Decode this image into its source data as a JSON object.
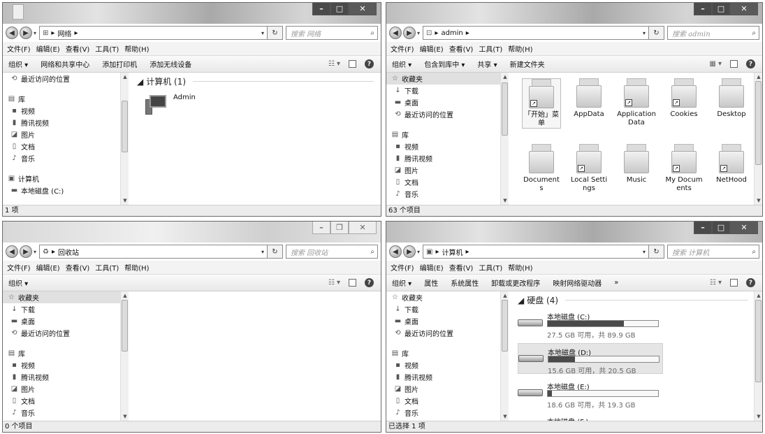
{
  "w1": {
    "address": [
      "网络"
    ],
    "search": "搜索 网络",
    "menu": [
      "文件(F)",
      "编辑(E)",
      "查看(V)",
      "工具(T)",
      "帮助(H)"
    ],
    "toolbar": [
      "组织 ▾",
      "网络和共享中心",
      "添加打印机",
      "添加无线设备"
    ],
    "nav": [
      {
        "label": "最近访问的位置",
        "icon": "recent-icon"
      },
      {
        "label": "库",
        "icon": "library-icon",
        "head": true
      },
      {
        "label": "视频",
        "icon": "video-icon"
      },
      {
        "label": "腾讯视频",
        "icon": "folder-icon"
      },
      {
        "label": "图片",
        "icon": "pictures-icon"
      },
      {
        "label": "文档",
        "icon": "docs-icon"
      },
      {
        "label": "音乐",
        "icon": "music-icon"
      },
      {
        "label": "计算机",
        "icon": "computer-icon",
        "head": true
      },
      {
        "label": "本地磁盘 (C:)",
        "icon": "drive-icon"
      }
    ],
    "group": "计算机 (1)",
    "items": [
      "Admin"
    ],
    "status": "1 项"
  },
  "w2": {
    "address": [
      "admin"
    ],
    "search": "搜索 admin",
    "menu": [
      "文件(F)",
      "编辑(E)",
      "查看(V)",
      "工具(T)",
      "帮助(H)"
    ],
    "toolbar": [
      "组织 ▾",
      "包含到库中 ▾",
      "共享 ▾",
      "新建文件夹"
    ],
    "nav": [
      {
        "label": "收藏夹",
        "icon": "star-icon",
        "head": true,
        "sel": true
      },
      {
        "label": "下载",
        "icon": "download-icon"
      },
      {
        "label": "桌面",
        "icon": "desktop-icon"
      },
      {
        "label": "最近访问的位置",
        "icon": "recent-icon"
      },
      {
        "label": "库",
        "icon": "library-icon",
        "head": true
      },
      {
        "label": "视频",
        "icon": "video-icon"
      },
      {
        "label": "腾讯视频",
        "icon": "folder-icon"
      },
      {
        "label": "图片",
        "icon": "pictures-icon"
      },
      {
        "label": "文档",
        "icon": "docs-icon"
      },
      {
        "label": "音乐",
        "icon": "music-icon"
      }
    ],
    "folders": [
      {
        "label": "「开始」菜单",
        "shortcut": true,
        "sel": true
      },
      {
        "label": "AppData"
      },
      {
        "label": "Application Data",
        "shortcut": true
      },
      {
        "label": "Cookies",
        "shortcut": true
      },
      {
        "label": "Desktop"
      },
      {
        "label": "Documents"
      },
      {
        "label": "Local Settings",
        "shortcut": true
      },
      {
        "label": "Music"
      },
      {
        "label": "My Documents",
        "shortcut": true
      },
      {
        "label": "NetHood",
        "shortcut": true
      }
    ],
    "status": "63 个项目"
  },
  "w3": {
    "address": [
      "回收站"
    ],
    "search": "搜索 回收站",
    "menu": [
      "文件(F)",
      "编辑(E)",
      "查看(V)",
      "工具(T)",
      "帮助(H)"
    ],
    "toolbar": [
      "组织 ▾"
    ],
    "nav": [
      {
        "label": "收藏夹",
        "icon": "star-icon",
        "head": true,
        "sel": true
      },
      {
        "label": "下载",
        "icon": "download-icon"
      },
      {
        "label": "桌面",
        "icon": "desktop-icon"
      },
      {
        "label": "最近访问的位置",
        "icon": "recent-icon"
      },
      {
        "label": "库",
        "icon": "library-icon",
        "head": true
      },
      {
        "label": "视频",
        "icon": "video-icon"
      },
      {
        "label": "腾讯视频",
        "icon": "folder-icon"
      },
      {
        "label": "图片",
        "icon": "pictures-icon"
      },
      {
        "label": "文档",
        "icon": "docs-icon"
      },
      {
        "label": "音乐",
        "icon": "music-icon"
      }
    ],
    "status": "0 个项目"
  },
  "w4": {
    "address": [
      "计算机"
    ],
    "search": "搜索 计算机",
    "menu": [
      "文件(F)",
      "编辑(E)",
      "查看(V)",
      "工具(T)",
      "帮助(H)"
    ],
    "toolbar": [
      "组织 ▾",
      "属性",
      "系统属性",
      "卸载或更改程序",
      "映射网络驱动器",
      "»"
    ],
    "nav": [
      {
        "label": "收藏夹",
        "icon": "star-icon",
        "head": true
      },
      {
        "label": "下载",
        "icon": "download-icon"
      },
      {
        "label": "桌面",
        "icon": "desktop-icon"
      },
      {
        "label": "最近访问的位置",
        "icon": "recent-icon"
      },
      {
        "label": "库",
        "icon": "library-icon",
        "head": true
      },
      {
        "label": "视频",
        "icon": "video-icon"
      },
      {
        "label": "腾讯视频",
        "icon": "folder-icon"
      },
      {
        "label": "图片",
        "icon": "pictures-icon"
      },
      {
        "label": "文档",
        "icon": "docs-icon"
      },
      {
        "label": "音乐",
        "icon": "music-icon"
      }
    ],
    "group": "硬盘 (4)",
    "disks": [
      {
        "name": "本地磁盘 (C:)",
        "free": "27.5 GB 可用，共 89.9 GB",
        "used_fraction": 0.69
      },
      {
        "name": "本地磁盘 (D:)",
        "free": "15.6 GB 可用，共 20.5 GB",
        "used_fraction": 0.24,
        "sel": true
      },
      {
        "name": "本地磁盘 (E:)",
        "free": "18.6 GB 可用，共 19.3 GB",
        "used_fraction": 0.04
      },
      {
        "name": "本地磁盘 (F:)",
        "free": "",
        "used_fraction": 0
      }
    ],
    "status": "已选择 1 项"
  },
  "colors": {
    "bar_fill": "#4a4a4a",
    "selection": "#e0e0e0"
  }
}
